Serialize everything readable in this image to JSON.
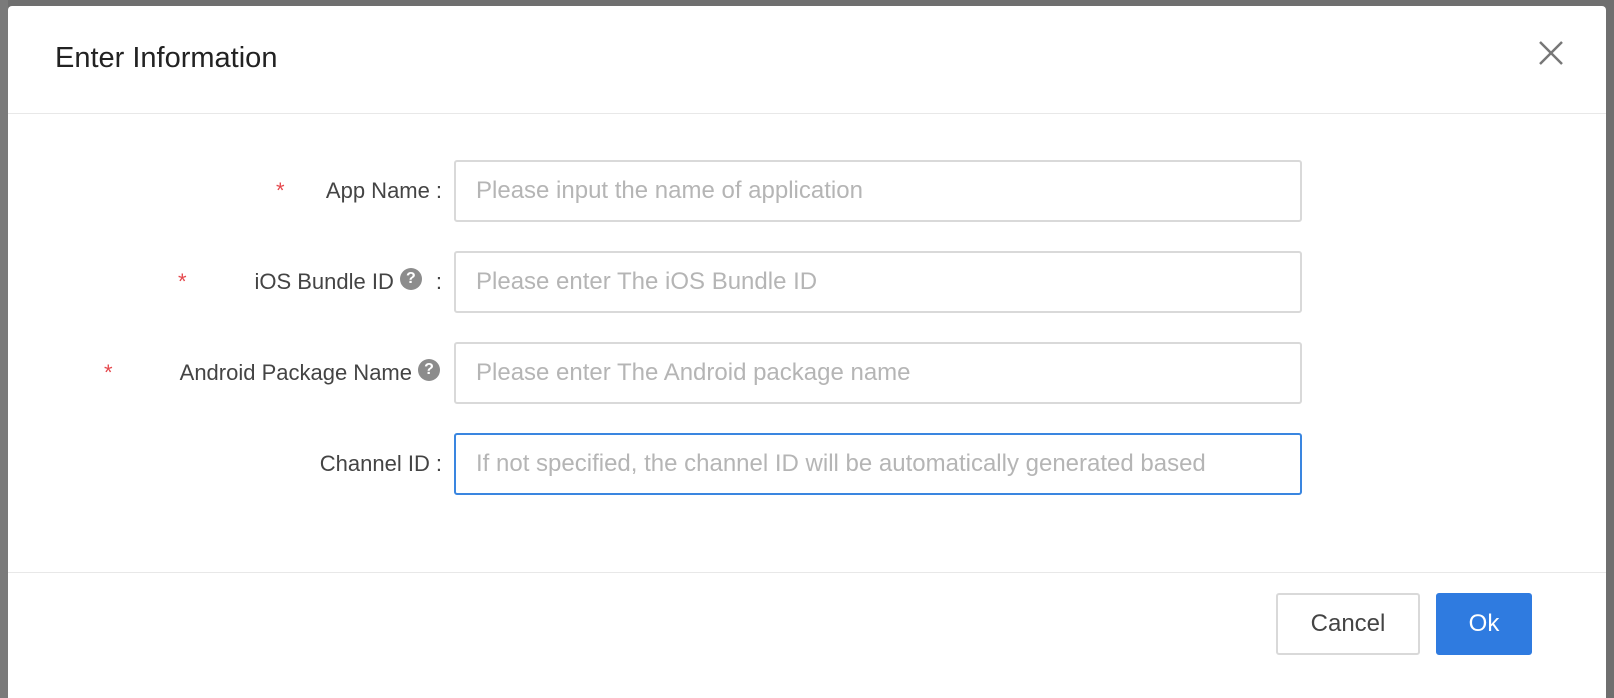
{
  "modal": {
    "title": "Enter Information",
    "close_icon": "close-icon"
  },
  "form": {
    "fields": [
      {
        "label": "App Name",
        "required": true,
        "help": false,
        "placeholder": "Please input the name of application",
        "value": ""
      },
      {
        "label": "iOS Bundle ID",
        "required": true,
        "help": true,
        "placeholder": "Please enter The iOS Bundle ID",
        "value": ""
      },
      {
        "label": "Android Package Name",
        "required": true,
        "help": true,
        "placeholder": "Please enter The Android package name",
        "value": ""
      },
      {
        "label": "Channel ID",
        "required": false,
        "help": false,
        "placeholder": "If not specified, the channel ID will be automatically generated based",
        "value": "",
        "focused": true
      }
    ],
    "required_mark": "*",
    "colon": ":",
    "help_glyph": "?"
  },
  "footer": {
    "cancel_label": "Cancel",
    "ok_label": "Ok"
  },
  "colors": {
    "primary": "#2f7be0",
    "required": "#e5484d",
    "focus_border": "#3a86e0"
  }
}
